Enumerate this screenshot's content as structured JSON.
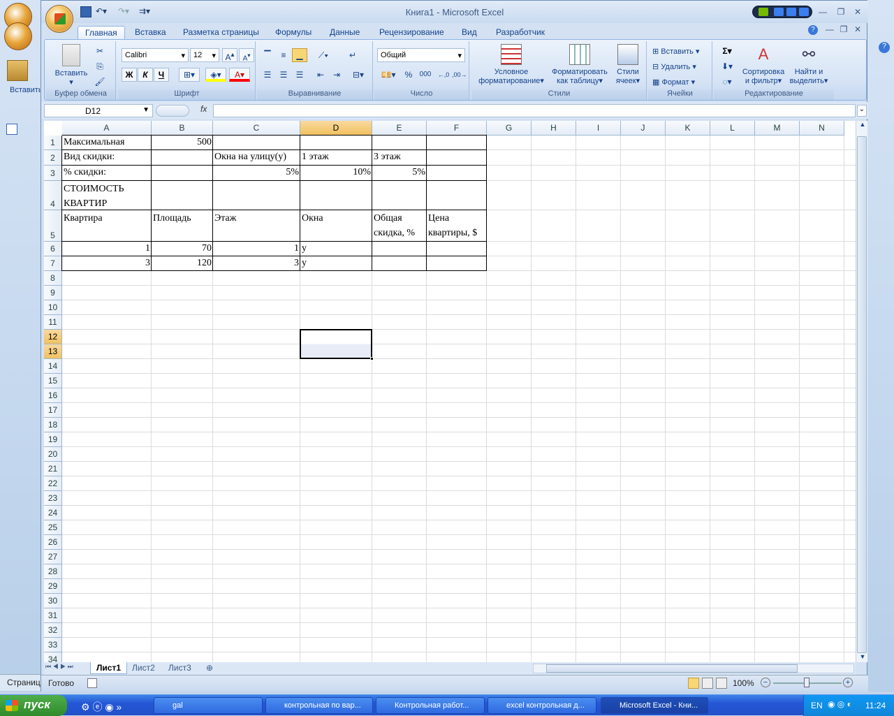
{
  "app": {
    "title": "Книга1 - Microsoft Excel"
  },
  "bg_window": {
    "vstavit": "Вставить",
    "status": "Страниц"
  },
  "tabs": [
    "Главная",
    "Вставка",
    "Разметка страницы",
    "Формулы",
    "Данные",
    "Рецензирование",
    "Вид",
    "Разработчик"
  ],
  "ribbon": {
    "clipboard": {
      "paste": "Вставить",
      "label": "Буфер обмена"
    },
    "font": {
      "name": "Calibri",
      "size": "12",
      "bold": "Ж",
      "italic": "К",
      "underline": "Ч",
      "label": "Шрифт"
    },
    "align": {
      "label": "Выравнивание"
    },
    "number": {
      "format": "Общий",
      "percent": "%",
      "thousands": "000",
      "label": "Число"
    },
    "styles": {
      "conditional": "Условное",
      "conditional2": "форматирование",
      "as_table": "Форматировать",
      "as_table2": "как таблицу",
      "cell_styles": "Стили",
      "cell_styles2": "ячеек",
      "label": "Стили"
    },
    "cells": {
      "insert": "Вставить",
      "delete": "Удалить",
      "format": "Формат",
      "label": "Ячейки"
    },
    "edit": {
      "sigma": "Σ",
      "sort": "Сортировка",
      "sort2": "и фильтр",
      "find": "Найти и",
      "find2": "выделить",
      "label": "Редактирование"
    }
  },
  "formula_bar": {
    "name_box": "D12",
    "fx": "fx",
    "value": ""
  },
  "columns": [
    "A",
    "B",
    "C",
    "D",
    "E",
    "F",
    "G",
    "H",
    "I",
    "J",
    "K",
    "L",
    "M",
    "N"
  ],
  "rows": [
    "1",
    "2",
    "3",
    "4",
    "5",
    "6",
    "7",
    "8",
    "9",
    "10",
    "11",
    "12",
    "13",
    "14",
    "15",
    "16",
    "17",
    "18",
    "19",
    "20",
    "21",
    "22",
    "23",
    "24",
    "25",
    "26",
    "27",
    "28",
    "29",
    "30",
    "31",
    "32",
    "33",
    "34"
  ],
  "cells": {
    "A1": "Максимальная",
    "B1": "500",
    "A2": "Вид скидки:",
    "C2": "Окна на улицу(у)",
    "D2": "1 этаж",
    "E2": "3 этаж",
    "A3": "% скидки:",
    "C3": "5%",
    "D3": "10%",
    "E3": "5%",
    "A4": "СТОИМОСТЬ КВАРТИР",
    "A5": "Квартира",
    "B5": "Площадь",
    "C5": "Этаж",
    "D5": "Окна",
    "E5": "Общая скидка, %",
    "F5": "Цена квартиры, $",
    "A6": "1",
    "B6": "70",
    "C6": "1",
    "D6": "у",
    "A7": "3",
    "B7": "120",
    "C7": "3",
    "D7": "у"
  },
  "sheets": [
    "Лист1",
    "Лист2",
    "Лист3"
  ],
  "status": {
    "ready": "Готово",
    "zoom": "100%"
  },
  "taskbar": {
    "start": "пуск",
    "items": [
      "gal",
      "контрольная по вар...",
      "Контрольная работ...",
      "excel контрольная д...",
      "Microsoft Excel - Кни..."
    ],
    "lang": "EN",
    "time": "11:24"
  }
}
